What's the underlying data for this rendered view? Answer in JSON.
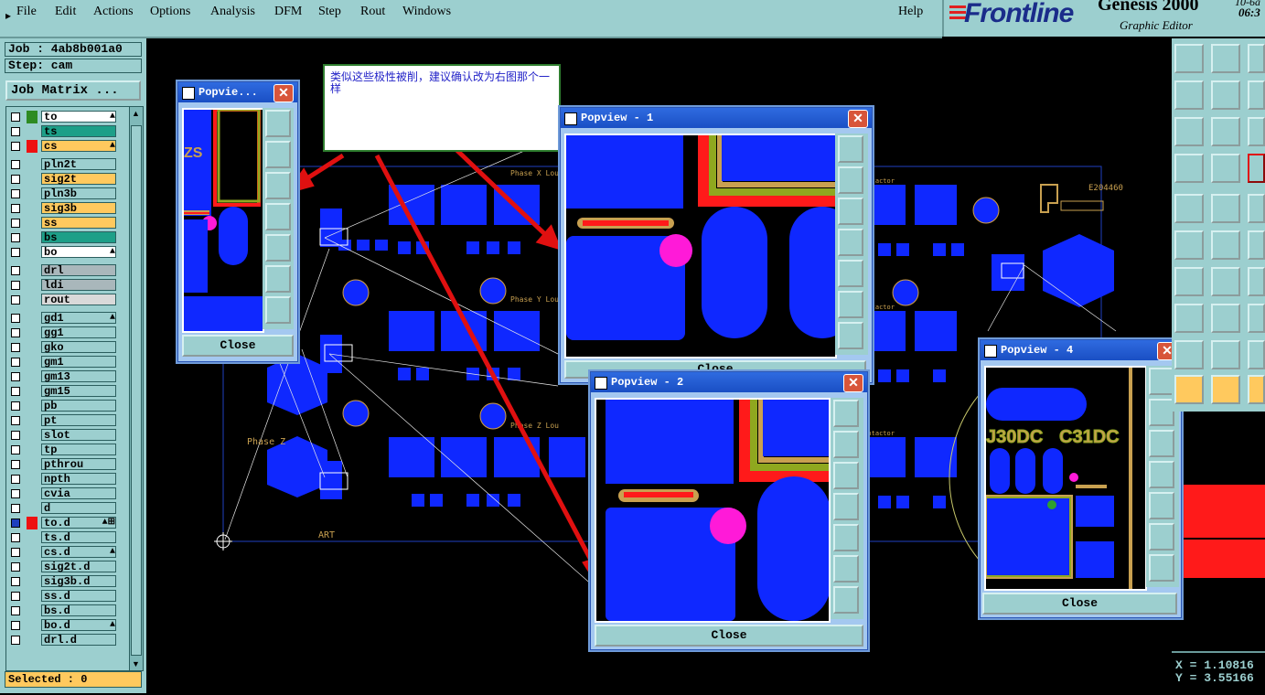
{
  "menubar": {
    "items": [
      "File",
      "Edit",
      "Actions",
      "Options",
      "Analysis",
      "DFM",
      "Step",
      "Rout",
      "Windows"
    ],
    "help": "Help"
  },
  "brand": {
    "logo": "Frontline",
    "product": "Genesis 2000",
    "subtitle": "Graphic Editor",
    "date_fragment": "10-6a",
    "time_fragment": "06:3"
  },
  "job_panel": {
    "job_line": "Job : 4ab8b001a0",
    "step_line": "Step: cam",
    "job_matrix_button": "Job Matrix ...",
    "selected": "Selected : 0"
  },
  "layers": [
    {
      "name": "to",
      "color": "#2e8b22",
      "bg": "#ffffff",
      "mark": "▲"
    },
    {
      "name": "ts",
      "color": "",
      "bg": "#1d9f88",
      "mark": ""
    },
    {
      "name": "cs",
      "color": "#e11",
      "bg": "#ffc95e",
      "mark": "▲"
    },
    {
      "name": "pln2t",
      "color": "",
      "bg": "#9ccfcf",
      "mark": ""
    },
    {
      "name": "sig2t",
      "color": "",
      "bg": "#ffc95e",
      "mark": ""
    },
    {
      "name": "pln3b",
      "color": "",
      "bg": "#9ccfcf",
      "mark": ""
    },
    {
      "name": "sig3b",
      "color": "",
      "bg": "#ffc95e",
      "mark": ""
    },
    {
      "name": "ss",
      "color": "",
      "bg": "#ffc95e",
      "mark": ""
    },
    {
      "name": "bs",
      "color": "",
      "bg": "#1d9f88",
      "mark": ""
    },
    {
      "name": "bo",
      "color": "",
      "bg": "#ffffff",
      "mark": "▲"
    },
    {
      "name": "drl",
      "color": "",
      "bg": "#a9b7bb",
      "mark": ""
    },
    {
      "name": "ldi",
      "color": "",
      "bg": "#a9b7bb",
      "mark": ""
    },
    {
      "name": "rout",
      "color": "",
      "bg": "#d9d9d9",
      "mark": ""
    },
    {
      "name": "gd1",
      "color": "",
      "bg": "#9ccfcf",
      "mark": "▲"
    },
    {
      "name": "gg1",
      "color": "",
      "bg": "#9ccfcf",
      "mark": ""
    },
    {
      "name": "gko",
      "color": "",
      "bg": "#9ccfcf",
      "mark": ""
    },
    {
      "name": "gm1",
      "color": "",
      "bg": "#9ccfcf",
      "mark": ""
    },
    {
      "name": "gm13",
      "color": "",
      "bg": "#9ccfcf",
      "mark": ""
    },
    {
      "name": "gm15",
      "color": "",
      "bg": "#9ccfcf",
      "mark": ""
    },
    {
      "name": "pb",
      "color": "",
      "bg": "#9ccfcf",
      "mark": ""
    },
    {
      "name": "pt",
      "color": "",
      "bg": "#9ccfcf",
      "mark": ""
    },
    {
      "name": "slot",
      "color": "",
      "bg": "#9ccfcf",
      "mark": ""
    },
    {
      "name": "tp",
      "color": "",
      "bg": "#9ccfcf",
      "mark": ""
    },
    {
      "name": "pthrou",
      "color": "",
      "bg": "#9ccfcf",
      "mark": ""
    },
    {
      "name": "npth",
      "color": "",
      "bg": "#9ccfcf",
      "mark": ""
    },
    {
      "name": "cvia",
      "color": "",
      "bg": "#9ccfcf",
      "mark": ""
    },
    {
      "name": "d",
      "color": "",
      "bg": "#9ccfcf",
      "mark": ""
    },
    {
      "name": "to.d",
      "color": "#e11",
      "bg": "#9ccfcf",
      "mark": "▲⊞"
    },
    {
      "name": "ts.d",
      "color": "",
      "bg": "#9ccfcf",
      "mark": ""
    },
    {
      "name": "cs.d",
      "color": "",
      "bg": "#9ccfcf",
      "mark": "▲"
    },
    {
      "name": "sig2t.d",
      "color": "",
      "bg": "#9ccfcf",
      "mark": ""
    },
    {
      "name": "sig3b.d",
      "color": "",
      "bg": "#9ccfcf",
      "mark": ""
    },
    {
      "name": "ss.d",
      "color": "",
      "bg": "#9ccfcf",
      "mark": ""
    },
    {
      "name": "bs.d",
      "color": "",
      "bg": "#9ccfcf",
      "mark": ""
    },
    {
      "name": "bo.d",
      "color": "",
      "bg": "#9ccfcf",
      "mark": "▲"
    },
    {
      "name": "drl.d",
      "color": "",
      "bg": "#9ccfcf",
      "mark": ""
    }
  ],
  "note": {
    "text": "类似这些极性被削，建议确认改为右图那个一样"
  },
  "popups": {
    "p0": {
      "title": "Popvie...",
      "close": "Close"
    },
    "p1": {
      "title": "Popview - 1",
      "close": "Close"
    },
    "p2": {
      "title": "Popview - 2",
      "close": "Close"
    },
    "p4": {
      "title": "Popview - 4",
      "close": "Close"
    }
  },
  "board": {
    "labels": [
      "Phase X Lou",
      "Phase Y Lou",
      "Phase Z Lou",
      "Phase Z",
      "ART",
      "E204460",
      "Contactor"
    ]
  },
  "popview4_text": {
    "left": "J30DC",
    "right": "C31DC"
  },
  "coords": {
    "x": "X = 1.10816",
    "y": "Y = 3.55166"
  },
  "colors": {
    "panel": "#9ccfcf",
    "pad": "#0f28ff",
    "copper_red": "#ff1a1a",
    "magenta": "#ff1ad8",
    "annotation_arrow": "#e01010"
  }
}
